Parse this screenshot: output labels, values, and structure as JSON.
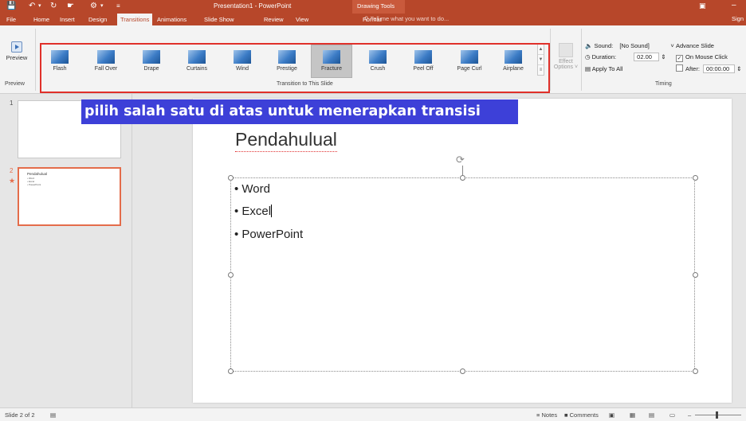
{
  "title_bar": {
    "title": "Presentation1 - PowerPoint",
    "context_group": "Drawing Tools",
    "qat": [
      "save-icon",
      "undo-icon",
      "redo-icon",
      "touch-mode-icon",
      "customize-icon"
    ]
  },
  "tabs": [
    {
      "label": "File"
    },
    {
      "label": "Home"
    },
    {
      "label": "Insert"
    },
    {
      "label": "Design"
    },
    {
      "label": "Transitions"
    },
    {
      "label": "Animations"
    },
    {
      "label": "Slide Show"
    },
    {
      "label": "Review"
    },
    {
      "label": "View"
    },
    {
      "label": "Format"
    }
  ],
  "tell_me": "Tell me what you want to do...",
  "sign_in": "Sign",
  "ribbon": {
    "preview_group": {
      "button": "Preview",
      "label": "Preview"
    },
    "transition_group": {
      "label": "Transition to This Slide",
      "items": [
        {
          "label": "Flash"
        },
        {
          "label": "Fall Over"
        },
        {
          "label": "Drape"
        },
        {
          "label": "Curtains"
        },
        {
          "label": "Wind"
        },
        {
          "label": "Prestige"
        },
        {
          "label": "Fracture"
        },
        {
          "label": "Crush"
        },
        {
          "label": "Peel Off"
        },
        {
          "label": "Page Curl"
        },
        {
          "label": "Airplane"
        }
      ],
      "selected": "Fracture"
    },
    "effect_options": {
      "line1": "Effect",
      "line2": "Options ˅"
    },
    "timing": {
      "label": "Timing",
      "sound_label": "Sound:",
      "sound_value": "[No Sound]",
      "duration_label": "Duration:",
      "duration_value": "02.00",
      "apply_all": "Apply To All",
      "advance_label": "Advance Slide",
      "on_mouse_click": "On Mouse Click",
      "on_mouse_click_checked": true,
      "after_label": "After:",
      "after_value": "00:00.00",
      "after_checked": false
    }
  },
  "banner": "pilih salah satu di atas untuk menerapkan transisi",
  "slides_panel": {
    "slide1_number": "1",
    "slide2_number": "2",
    "thumb2_title": "Pendahulual",
    "thumb2_bullets": [
      "• Word",
      "• Excel",
      "• PowerPoint"
    ]
  },
  "slide": {
    "title": "Pendahulual",
    "bullets": [
      "Word",
      "Excel",
      "PowerPoint"
    ]
  },
  "status_bar": {
    "slide_info": "Slide 2 of 2",
    "notes": "Notes",
    "comments": "Comments"
  }
}
